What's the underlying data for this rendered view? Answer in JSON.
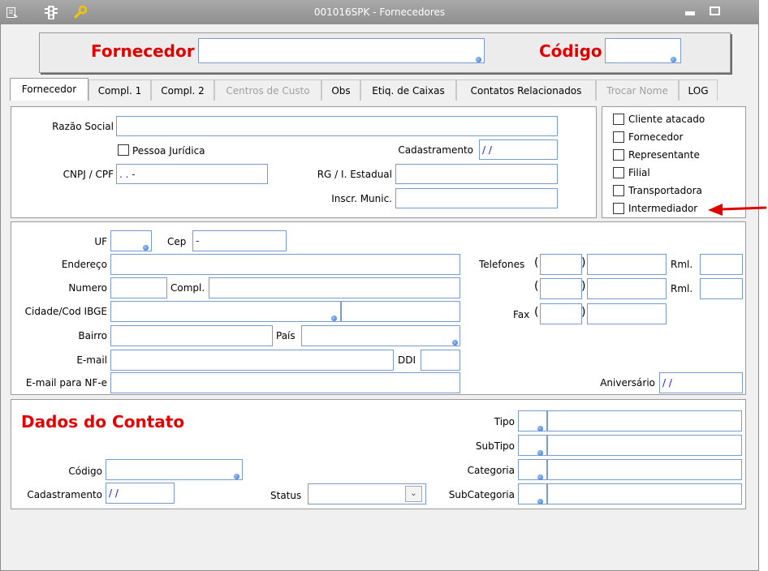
{
  "window": {
    "title": "001016SPK - Fornecedores"
  },
  "header": {
    "fornecedor_label": "Fornecedor",
    "codigo_label": "Código"
  },
  "tabs": [
    {
      "label": "Fornecedor"
    },
    {
      "label": "Compl. 1"
    },
    {
      "label": "Compl. 2"
    },
    {
      "label": "Centros de Custo"
    },
    {
      "label": "Obs"
    },
    {
      "label": "Etiq. de Caixas"
    },
    {
      "label": "Contatos Relacionados"
    },
    {
      "label": "Trocar Nome"
    },
    {
      "label": "LOG"
    }
  ],
  "basic": {
    "razao_social_label": "Razão Social",
    "pessoa_juridica_label": "Pessoa Jurídica",
    "cadastramento_label": "Cadastramento",
    "cadastramento_value": "/ /",
    "cnpj_label": "CNPJ / CPF",
    "cnpj_value": ". . -",
    "rg_label": "RG / I. Estadual",
    "inscr_label": "Inscr. Munic."
  },
  "types": [
    {
      "label": "Cliente atacado"
    },
    {
      "label": "Fornecedor"
    },
    {
      "label": "Representante"
    },
    {
      "label": "Filial"
    },
    {
      "label": "Transportadora"
    },
    {
      "label": "Intermediador"
    }
  ],
  "address": {
    "uf_label": "UF",
    "cep_label": "Cep",
    "cep_value": "-",
    "endereco_label": "Endereço",
    "numero_label": "Numero",
    "compl_label": "Compl.",
    "cidade_label": "Cidade/Cod IBGE",
    "bairro_label": "Bairro",
    "pais_label": "País",
    "email_label": "E-mail",
    "ddi_label": "DDI",
    "email_nfe_label": "E-mail para NF-e",
    "telefones_label": "Telefones",
    "rml_label": "Rml.",
    "fax_label": "Fax",
    "open_paren": "(",
    "close_paren": ")",
    "aniversario_label": "Aniversário",
    "aniversario_value": "/ /"
  },
  "contact": {
    "title": "Dados do Contato",
    "codigo_label": "Código",
    "cadastramento_label": "Cadastramento",
    "cadastramento_value": "/ /",
    "status_label": "Status",
    "tipo_label": "Tipo",
    "subtipo_label": "SubTipo",
    "categoria_label": "Categoria",
    "subcategoria_label": "SubCategoria"
  },
  "colors": {
    "accent_red": "#e00000",
    "field_border": "#7a9bd0",
    "titlebar": "#9a9a9a"
  }
}
